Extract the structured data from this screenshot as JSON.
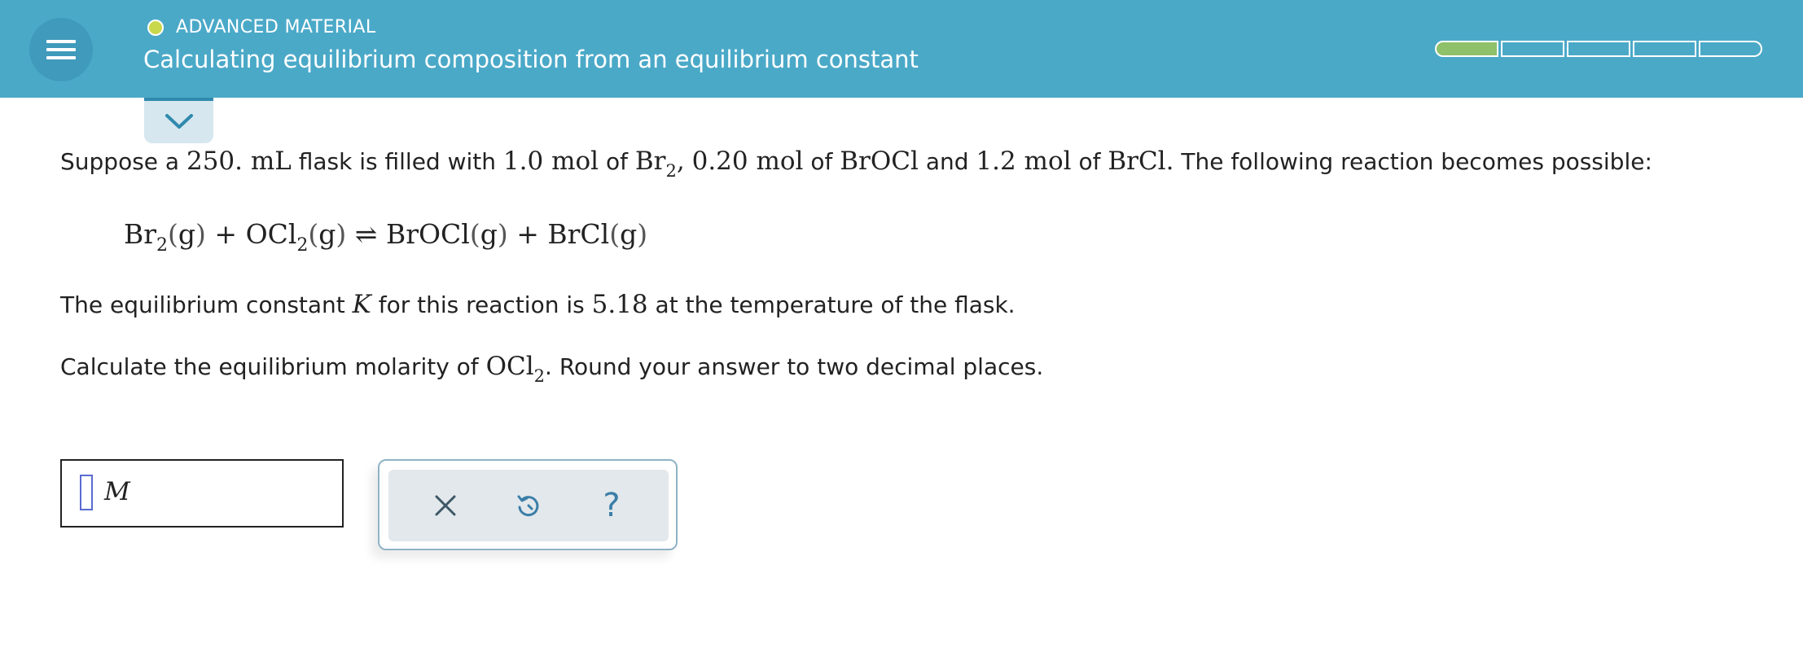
{
  "header": {
    "section_label": "ADVANCED MATERIAL",
    "topic_title": "Calculating equilibrium composition from an equilibrium constant",
    "status_color": "#c9d84a",
    "progress": {
      "filled_segments": 1,
      "total_segments": 5
    }
  },
  "problem": {
    "line1": {
      "t1": "Suppose a ",
      "m1": "250. mL",
      "t2": " flask is filled with ",
      "m2": "1.0 mol",
      "t3": " of ",
      "m3": "Br",
      "m3_sub": "2",
      "m3_after": ",",
      "m4": "0.20 mol",
      "t4": " of ",
      "m5": "BrOCl",
      "t5": " and ",
      "m6": "1.2 mol",
      "t6": " of ",
      "m7": "BrCl.",
      "t7": " The following reaction becomes possible:"
    },
    "equation": {
      "sp1": "Br",
      "sp1_sub": "2",
      "sp2": "OCl",
      "sp2_sub": "2",
      "sp3": "BrOCl",
      "sp4": "BrCl",
      "state": "g",
      "plus": "+",
      "arrow": "⇌"
    },
    "line2": {
      "t1": "The equilibrium constant ",
      "k": "K",
      "t2": " for this reaction is ",
      "value": "5.18",
      "t3": " at the temperature of the flask."
    },
    "line3": {
      "t1": "Calculate the equilibrium molarity of ",
      "sp": "OCl",
      "sp_sub": "2",
      "t2": ". Round your answer to two decimal places."
    }
  },
  "answer": {
    "value": "",
    "unit": "M"
  },
  "tools": {
    "clear_icon": "close-icon",
    "undo_icon": "undo-icon",
    "help_label": "?"
  }
}
